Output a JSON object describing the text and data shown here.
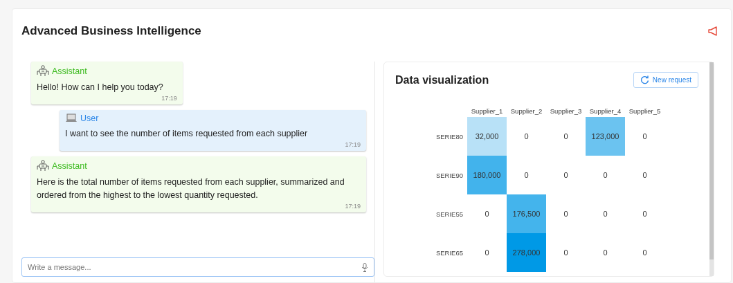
{
  "title": "Advanced Business Intelligence",
  "messages": [
    {
      "kind": "assistant",
      "sender": "Assistant",
      "text": "Hello! How can I help you today?",
      "time": "17:19"
    },
    {
      "kind": "user",
      "sender": "User",
      "text": "I want to see the number of items requested from each supplier",
      "time": "17:19"
    },
    {
      "kind": "assistant",
      "sender": "Assistant",
      "text": "Here is the total number of items requested from each supplier, summarized and ordered from the highest to the lowest quantity requested.",
      "time": "17:19"
    }
  ],
  "composer": {
    "placeholder": "Write a message..."
  },
  "visualization": {
    "title": "Data visualization",
    "button": "New request",
    "columns": [
      "Supplier_1",
      "Supplier_2",
      "Supplier_3",
      "Supplier_4",
      "Supplier_5"
    ],
    "rows": [
      {
        "label": "SERIE80",
        "cells": [
          "32,000",
          "0",
          "0",
          "123,000",
          "0"
        ]
      },
      {
        "label": "SERIE90",
        "cells": [
          "180,000",
          "0",
          "0",
          "0",
          "0"
        ]
      },
      {
        "label": "SERIE55",
        "cells": [
          "0",
          "176,500",
          "0",
          "0",
          "0"
        ]
      },
      {
        "label": "SERIE65",
        "cells": [
          "0",
          "278,000",
          "0",
          "0",
          "0"
        ]
      }
    ]
  }
}
